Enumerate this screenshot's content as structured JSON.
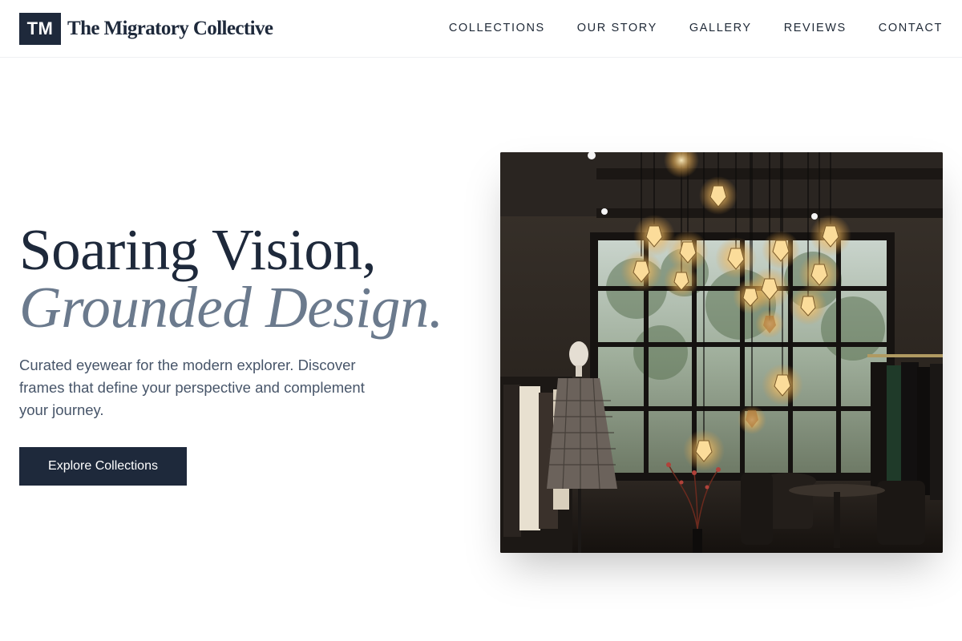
{
  "header": {
    "logo_mark": "TM",
    "logo_name": "The Migratory Collective",
    "nav": [
      {
        "label": "COLLECTIONS"
      },
      {
        "label": "OUR STORY"
      },
      {
        "label": "GALLERY"
      },
      {
        "label": "REVIEWS"
      },
      {
        "label": "CONTACT"
      }
    ]
  },
  "hero": {
    "title_line1": "Soaring Vision,",
    "title_line2": "Grounded Design.",
    "subtitle": "Curated eyewear for the modern explorer. Discover frames that define your perspective and complement your journey.",
    "cta_label": "Explore Collections",
    "image_alt": "Boutique interior with hanging Edison bulbs, mannequin and clothing racks"
  },
  "colors": {
    "primary": "#1e293b",
    "accent_italic": "#6b7a8d",
    "body_text": "#475569",
    "background": "#ffffff"
  }
}
